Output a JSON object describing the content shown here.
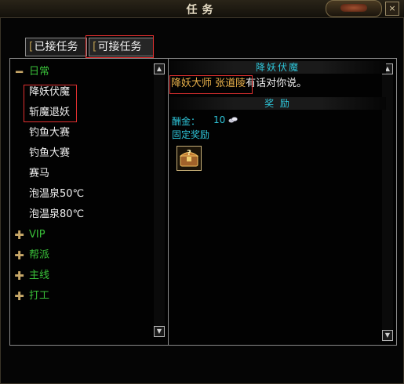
{
  "window": {
    "title": "任务",
    "close_label": "×",
    "close_icon": "close-icon",
    "ornament_icon": "dragon-ornament-icon"
  },
  "tabs": [
    {
      "label": "已接任务",
      "active": false
    },
    {
      "label": "可接任务",
      "active": true
    }
  ],
  "quest_tree": {
    "categories": [
      {
        "label": "日常",
        "expanded": true,
        "icon": "minus-icon",
        "items": [
          "降妖伏魔",
          "斩魔退妖",
          "钓鱼大赛",
          "钓鱼大赛",
          "赛马",
          "泡温泉50℃",
          "泡温泉80℃"
        ]
      },
      {
        "label": "VIP",
        "expanded": false,
        "icon": "plus-icon"
      },
      {
        "label": "帮派",
        "expanded": false,
        "icon": "plus-icon"
      },
      {
        "label": "主线",
        "expanded": false,
        "icon": "plus-icon"
      },
      {
        "label": "打工",
        "expanded": false,
        "icon": "plus-icon"
      }
    ]
  },
  "detail": {
    "quest_title": "降妖伏魔",
    "npc_name": "降妖大师 张道陵",
    "dialog_text": "有话对你说。",
    "reward_header": "奖 励",
    "reward_currency_label": "酬金：",
    "reward_currency_value": "10",
    "reward_currency_icon": "silver-coin-icon",
    "fixed_reward_label": "固定奖励",
    "fixed_reward_icon": "treasure-chest-icon"
  },
  "colors": {
    "category_green": "#39c039",
    "section_cyan": "#2ec4d8",
    "npc_gold": "#e8b04a",
    "highlight_red": "#e03030"
  }
}
